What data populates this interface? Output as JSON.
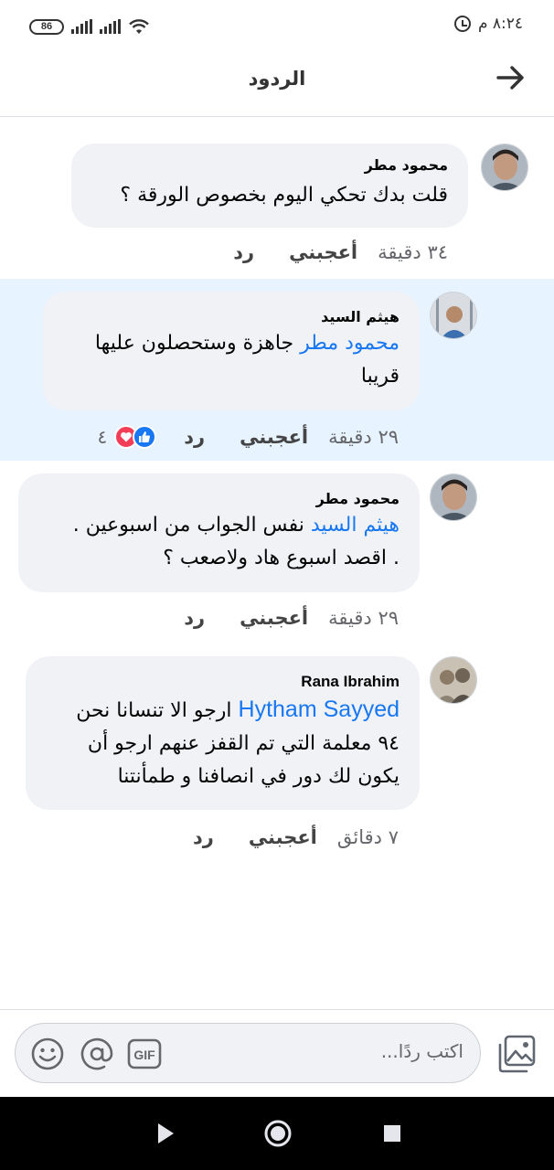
{
  "status_bar": {
    "time": "٨:٢٤ م",
    "battery": "86"
  },
  "header": {
    "title": "الردود"
  },
  "comments": [
    {
      "author": "محمود مطر",
      "mention": "",
      "text": "قلت بدك تحكي اليوم بخصوص الورقة ؟",
      "time": "٣٤ دقيقة",
      "like_label": "أعجبني",
      "reply_label": "رد"
    },
    {
      "author": "هيثم السيد",
      "mention": "محمود مطر",
      "text_line1": " جاهزة وستحصلون عليها",
      "text_line2": "قريبا",
      "time": "٢٩ دقيقة",
      "like_label": "أعجبني",
      "reply_label": "رد",
      "reaction_count": "٤"
    },
    {
      "author": "محمود مطر",
      "mention": "هيثم السيد",
      "text_line1": " نفس الجواب من اسبوعين .",
      "text_line2": ". اقصد اسبوع هاد ولاصعب ؟",
      "time": "٢٩ دقيقة",
      "like_label": "أعجبني",
      "reply_label": "رد"
    },
    {
      "author": "Rana Ibrahim",
      "mention": "Hytham Sayyed",
      "text_line1": " ارجو الا تنسانا نحن",
      "text_line2": "٩٤ معلمة التي تم القفز عنهم ارجو أن",
      "text_line3": "يكون لك دور في انصافنا و طمأنتنا",
      "time": "٧ دقائق",
      "like_label": "أعجبني",
      "reply_label": "رد"
    }
  ],
  "composer": {
    "placeholder": "اكتب ردًا..."
  },
  "colors": {
    "accent": "#1877f2",
    "bubble": "#f0f2f5",
    "highlight": "#e7f3ff",
    "love": "#f33e58"
  },
  "icons": [
    "battery-icon",
    "signal-icon",
    "wifi-icon",
    "alarm-icon",
    "back-arrow-icon",
    "photo-icon",
    "gif-icon",
    "mention-icon",
    "emoji-icon",
    "nav-back-icon",
    "nav-home-icon",
    "nav-recents-icon"
  ]
}
